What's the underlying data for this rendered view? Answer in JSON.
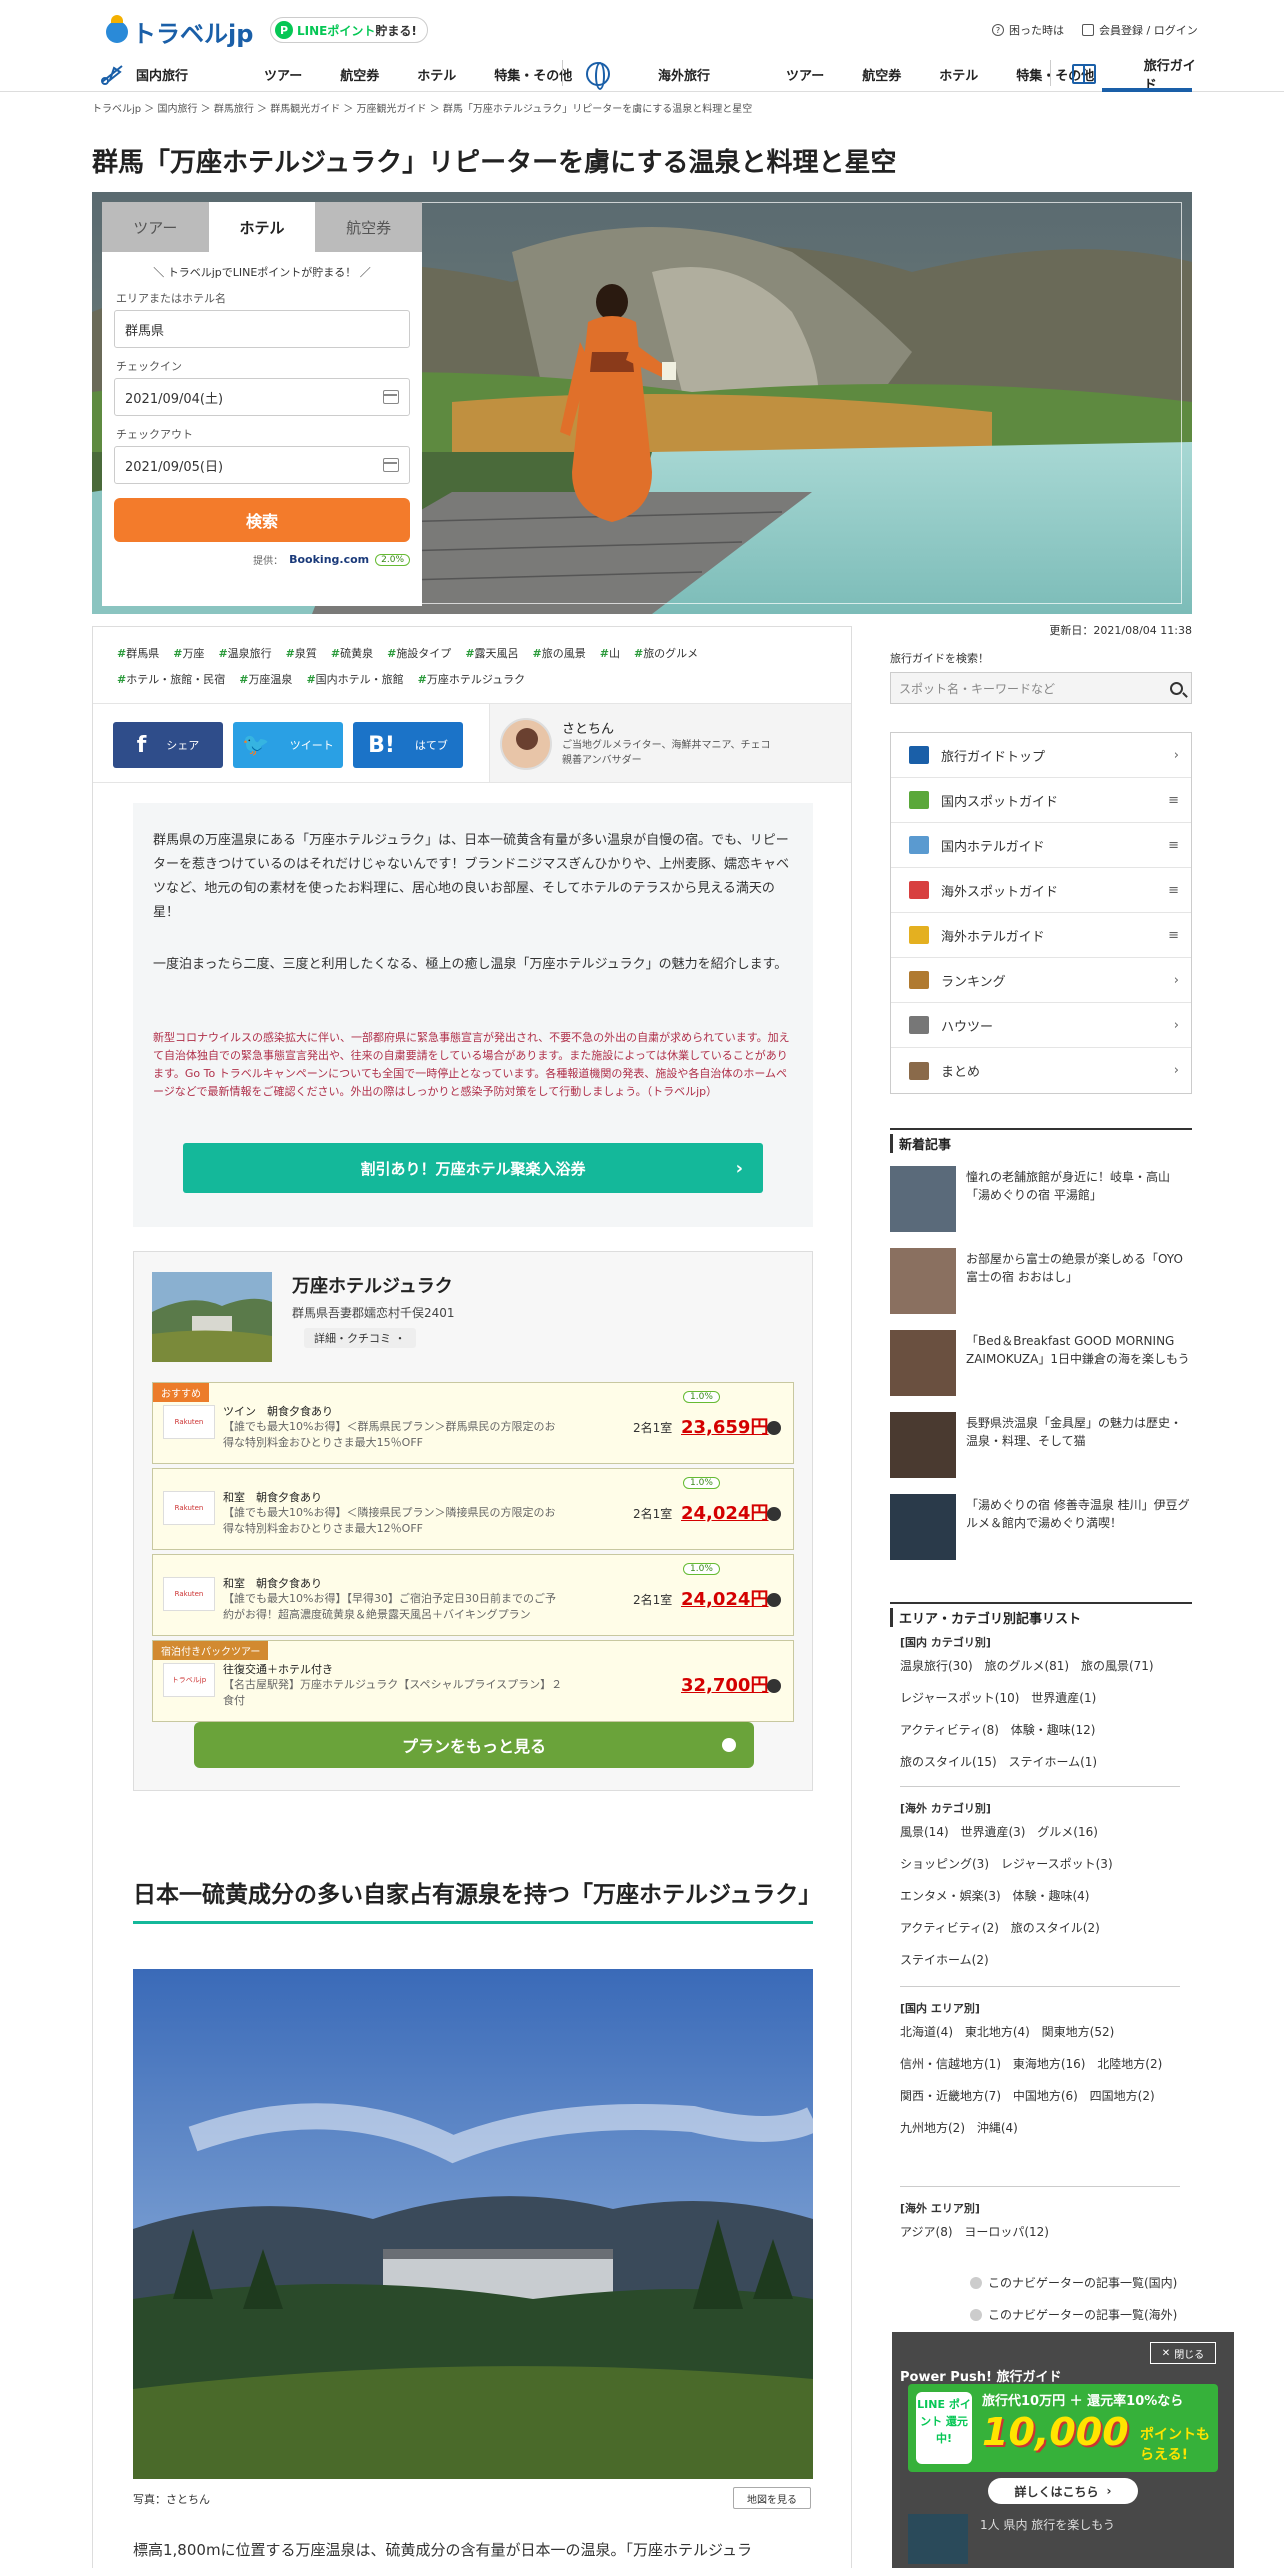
{
  "header": {
    "logo_text": "トラベルjp",
    "line_badge": {
      "prefix": "LINEポイント",
      "suffix": "貯まる!"
    },
    "help_link": "困った時は",
    "login_link": "会員登録 / ログイン",
    "nav_domestic": {
      "head": "国内旅行",
      "items": [
        "ツアー",
        "航空券",
        "ホテル",
        "特集・その他"
      ]
    },
    "nav_overseas": {
      "head": "海外旅行",
      "items": [
        "ツアー",
        "航空券",
        "ホテル",
        "特集・その他"
      ]
    },
    "nav_guide": "旅行ガイド"
  },
  "breadcrumb": "トラベルjp ＞ 国内旅行 ＞ 群馬旅行 ＞ 群馬観光ガイド ＞ 万座観光ガイド ＞ 群馬「万座ホテルジュラク」リピーターを虜にする温泉と料理と星空",
  "title": "群馬「万座ホテルジュラク」リピーターを虜にする温泉と料理と星空",
  "searchbox": {
    "tabs": [
      "ツアー",
      "ホテル",
      "航空券"
    ],
    "promo": "＼ トラベルjpでLINEポイントが貯まる！ ／",
    "area_label": "エリアまたはホテル名",
    "area_value": "群馬県",
    "checkin_label": "チェックイン",
    "checkin_value": "2021/09/04(土)",
    "checkout_label": "チェックアウト",
    "checkout_value": "2021/09/05(日)",
    "search_button": "検索",
    "provider_label": "提供：",
    "provider": "Booking.com",
    "points": "2.0%"
  },
  "updated": "更新日：2021/08/04 11:38",
  "tags": [
    "群馬県",
    "万座",
    "温泉旅行",
    "泉質",
    "硫黄泉",
    "施設タイプ",
    "露天風呂",
    "旅の風景",
    "山",
    "旅のグルメ",
    "ホテル・旅館・民宿",
    "万座温泉",
    "国内ホテル・旅館",
    "万座ホテルジュラク"
  ],
  "share": {
    "facebook": "シェア",
    "twitter": "ツイート",
    "hatena": "はてブ"
  },
  "author": {
    "name": "さとちん",
    "desc": "ご当地グルメライター、海鮮丼マニア、チェコ親善アンバサダー"
  },
  "intro": {
    "p1": "群馬県の万座温泉にある「万座ホテルジュラク」は、日本一硫黄含有量が多い温泉が自慢の宿。でも、リピーターを惹きつけているのはそれだけじゃないんです！ブランドニジマスぎんひかりや、上州麦豚、嬬恋キャベツなど、地元の旬の素材を使ったお料理に、居心地の良いお部屋、そしてホテルのテラスから見える満天の星！",
    "p2": "一度泊まったら二度、三度と利用したくなる、極上の癒し温泉「万座ホテルジュラク」の魅力を紹介します。",
    "notice": "新型コロナウイルスの感染拡大に伴い、一部都府県に緊急事態宣言が発出され、不要不急の外出の自粛が求められています。加えて自治体独自での緊急事態宣言発出や、往来の自粛要請をしている場合があります。また施設によっては休業していることがあります。Go To トラベルキャンペーンについても全国で一時停止となっています。各種報道機関の発表、施設や各自治体のホームページなどで最新情報をご確認ください。外出の際はしっかりと感染予防対策をして行動しましょう。（トラベルjp）",
    "cta": "割引あり！万座ホテル聚楽入浴券"
  },
  "hotel": {
    "name": "万座ホテルジュラク",
    "address": "群馬県吾妻郡嬬恋村千俣2401",
    "detail_button": "詳細・クチコミ ・",
    "plans": [
      {
        "tag": "おすすめ",
        "logo": "Rakuten",
        "title": "ツイン　朝食夕食あり",
        "desc": "【誰でも最大10%お得】＜群馬県民プラン＞群馬県民の方限定のお得な特別料金おひとりさま最大15％OFF",
        "room": "2名1室",
        "price": "23,659円",
        "points": "1.0%"
      },
      {
        "tag": "",
        "logo": "Rakuten",
        "title": "和室　朝食夕食あり",
        "desc": "【誰でも最大10%お得】＜隣接県民プラン＞隣接県民の方限定のお得な特別料金おひとりさま最大12％OFF",
        "room": "2名1室",
        "price": "24,024円",
        "points": "1.0%"
      },
      {
        "tag": "",
        "logo": "Rakuten",
        "title": "和室　朝食夕食あり",
        "desc": "【誰でも最大10%お得】【早得30】ご宿泊予定日30日前までのご予約がお得！超高濃度硫黄泉＆絶景露天風呂＋バイキングプラン",
        "room": "2名1室",
        "price": "24,024円",
        "points": "1.0%"
      },
      {
        "tag": "宿泊付きパックツアー",
        "logo": "トラベルjp",
        "title": "往復交通＋ホテル付き",
        "desc": "【名古屋駅発】万座ホテルジュラク【スペシャルプライスプラン】２食付",
        "room": "",
        "price": "32,700円",
        "points": ""
      }
    ],
    "more_button": "プランをもっと見る"
  },
  "section_heading": "日本一硫黄成分の多い自家占有源泉を持つ「万座ホテルジュラク」",
  "photo_caption": "写真：さとちん",
  "map_button": "地図を見る",
  "body_text": "標高1,800mに位置する万座温泉は、硫黄成分の含有量が日本一の温泉。「万座ホテルジュラ",
  "sidebar": {
    "search_label": "旅行ガイドを検索！",
    "search_placeholder": "スポット名・キーワードなど",
    "menu": [
      {
        "label": "旅行ガイドトップ",
        "arrow": "›",
        "color": "#1a5fa8"
      },
      {
        "label": "国内スポットガイド",
        "arrow": "≡",
        "color": "#5aa83a"
      },
      {
        "label": "国内ホテルガイド",
        "arrow": "≡",
        "color": "#5a9ad0"
      },
      {
        "label": "海外スポットガイド",
        "arrow": "≡",
        "color": "#d84040"
      },
      {
        "label": "海外ホテルガイド",
        "arrow": "≡",
        "color": "#e4b020"
      },
      {
        "label": "ランキング",
        "arrow": "›",
        "color": "#b07a30"
      },
      {
        "label": "ハウツー",
        "arrow": "›",
        "color": "#777"
      },
      {
        "label": "まとめ",
        "arrow": "›",
        "color": "#8a6a4a"
      }
    ],
    "news_heading": "新着記事",
    "news": [
      "憧れの老舗旅館が身近に！岐阜・高山「湯めぐりの宿 平湯館」",
      "お部屋から富士の絶景が楽しめる「OYO 富士の宿 おおはし」",
      "「Bed＆Breakfast GOOD MORNING ZAIMOKUZA」1日中鎌倉の海を楽しもう",
      "長野県渋温泉「金具屋」の魅力は歴史・温泉・料理、そして猫",
      "「湯めぐりの宿 修善寺温泉 桂川」伊豆グルメ＆館内で湯めぐり満喫！"
    ],
    "category_heading": "エリア・カテゴリ別記事リスト",
    "dom_cat_title": "[国内 カテゴリ別]",
    "dom_cat": [
      "温泉旅行(30)",
      "旅のグルメ(81)",
      "旅の風景(71)",
      "レジャースポット(10)",
      "世界遺産(1)",
      "アクティビティ(8)",
      "体験・趣味(12)",
      "旅のスタイル(15)",
      "ステイホーム(1)"
    ],
    "ovs_cat_title": "[海外 カテゴリ別]",
    "ovs_cat": [
      "風景(14)",
      "世界遺産(3)",
      "グルメ(16)",
      "ショッピング(3)",
      "レジャースポット(3)",
      "エンタメ・娯楽(3)",
      "体験・趣味(4)",
      "アクティビティ(2)",
      "旅のスタイル(2)",
      "ステイホーム(2)"
    ],
    "dom_area_title": "[国内 エリア別]",
    "dom_area": [
      "北海道(4)",
      "東北地方(4)",
      "関東地方(52)",
      "信州・信越地方(1)",
      "東海地方(16)",
      "北陸地方(2)",
      "関西・近畿地方(7)",
      "中国地方(6)",
      "四国地方(2)",
      "九州地方(2)",
      "沖縄(4)"
    ],
    "ovs_area_title": "[海外 エリア別]",
    "ovs_area": [
      "アジア(8)",
      "ヨーロッパ(12)"
    ],
    "navigator_dom": "このナビゲーターの記事一覧(国内)",
    "navigator_ovs": "このナビゲーターの記事一覧(海外)"
  },
  "popup": {
    "close": "閉じる",
    "title": "Power Push! 旅行ガイド",
    "line_text": "LINE ポイント 還元中!",
    "headline": "旅行代10万円 ＋ 還元率10%なら",
    "amount": "10,000",
    "amount_unit": "ポイントもらえる!",
    "cta": "詳しくはこちら",
    "extra_text": "1人 県内 旅行を楽しもう"
  },
  "colors": {
    "brand_blue": "#1a5fa8",
    "accent_green": "#14b89a",
    "search_orange": "#f37b2b",
    "price_red": "#d40000"
  }
}
